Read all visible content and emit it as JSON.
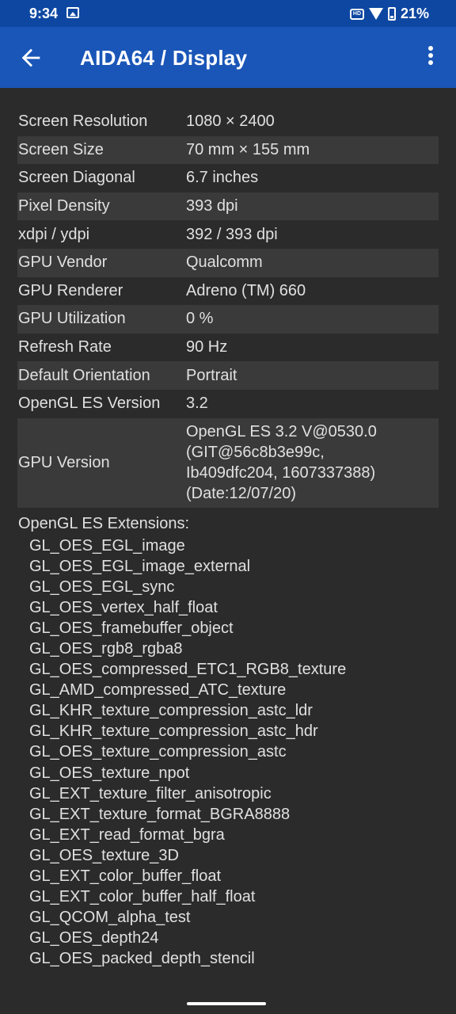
{
  "status_bar": {
    "time": "9:34",
    "battery": "21%",
    "icons": [
      "photo-icon",
      "hd-icon",
      "wifi-icon",
      "battery-icon"
    ]
  },
  "app_bar": {
    "title": "AIDA64  /  Display",
    "back_icon": "arrow-left-icon",
    "menu_icon": "more-vert-icon"
  },
  "info": {
    "rows": [
      {
        "label": "Screen Resolution",
        "value": "1080 × 2400"
      },
      {
        "label": "Screen Size",
        "value": "70 mm × 155 mm"
      },
      {
        "label": "Screen Diagonal",
        "value": "6.7 inches"
      },
      {
        "label": "Pixel Density",
        "value": "393 dpi"
      },
      {
        "label": "xdpi / ydpi",
        "value": "392 / 393 dpi"
      },
      {
        "label": "GPU Vendor",
        "value": "Qualcomm"
      },
      {
        "label": "GPU Renderer",
        "value": "Adreno (TM) 660"
      },
      {
        "label": "GPU Utilization",
        "value": "0 %"
      },
      {
        "label": "Refresh Rate",
        "value": "90 Hz"
      },
      {
        "label": "Default Orientation",
        "value": "Portrait"
      },
      {
        "label": "OpenGL ES Version",
        "value": "3.2"
      }
    ],
    "gpu_version": {
      "label": "GPU Version",
      "lines": [
        "OpenGL ES 3.2 V@0530.0",
        "(GIT@56c8b3e99c,",
        "Ib409dfc204, 1607337388)",
        "(Date:12/07/20)"
      ]
    }
  },
  "extensions": {
    "title": "OpenGL ES Extensions:",
    "items": [
      "GL_OES_EGL_image",
      "GL_OES_EGL_image_external",
      "GL_OES_EGL_sync",
      "GL_OES_vertex_half_float",
      "GL_OES_framebuffer_object",
      "GL_OES_rgb8_rgba8",
      "GL_OES_compressed_ETC1_RGB8_texture",
      "GL_AMD_compressed_ATC_texture",
      "GL_KHR_texture_compression_astc_ldr",
      "GL_KHR_texture_compression_astc_hdr",
      "GL_OES_texture_compression_astc",
      "GL_OES_texture_npot",
      "GL_EXT_texture_filter_anisotropic",
      "GL_EXT_texture_format_BGRA8888",
      "GL_EXT_read_format_bgra",
      "GL_OES_texture_3D",
      "GL_EXT_color_buffer_float",
      "GL_EXT_color_buffer_half_float",
      "GL_QCOM_alpha_test",
      "GL_OES_depth24",
      "GL_OES_packed_depth_stencil"
    ]
  },
  "colors": {
    "app_bar": "#1a56b8",
    "status_bar": "#0d47a1",
    "background": "#2b2b2b",
    "row_alt": "#3a3a3a"
  }
}
